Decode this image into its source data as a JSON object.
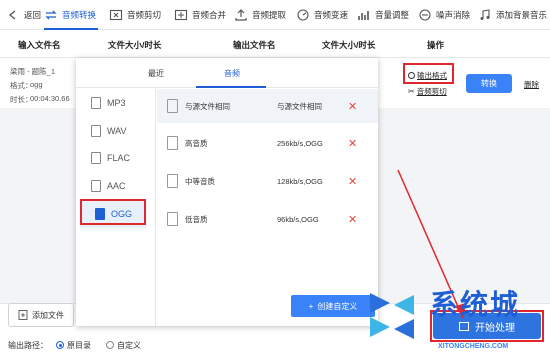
{
  "toolbar": {
    "back": "返回",
    "items": [
      "音频转换",
      "音频剪切",
      "音频合并",
      "音频提取",
      "音频变速",
      "音量调整",
      "噪声消除",
      "添加背景音乐"
    ]
  },
  "columns": {
    "input_name": "输入文件名",
    "size_duration": "文件大小/时长",
    "output_name": "输出文件名",
    "size_duration2": "文件大小/时长",
    "action": "操作"
  },
  "file": {
    "name": "梁雨 - 题陈_1",
    "format_label": "格式：",
    "format": "ogg",
    "duration_label": "时长：",
    "duration": "00:04:30.66"
  },
  "row_actions": {
    "output_format": "输出格式",
    "convert": "转换",
    "delete": "删除",
    "audio_cut": "音频剪切"
  },
  "popup": {
    "tabs": [
      "最近",
      "音频"
    ],
    "active_tab": "音频",
    "formats": [
      "MP3",
      "WAV",
      "FLAC",
      "AAC",
      "OGG"
    ],
    "selected_format": "OGG",
    "qualities": [
      {
        "name": "与源文件相同",
        "value": "与源文件相同"
      },
      {
        "name": "高音质",
        "value": "256kb/s,OGG"
      },
      {
        "name": "中等音质",
        "value": "128kb/s,OGG"
      },
      {
        "name": "低音质",
        "value": "96kb/s,OGG"
      }
    ],
    "create_custom": "创建自定义"
  },
  "bottom": {
    "add_file": "添加文件",
    "output_path": "输出路径：",
    "options": [
      "原目录",
      "自定义"
    ],
    "selected_option": "原目录",
    "start": "开始处理"
  },
  "watermark": {
    "text": "系统城",
    "url": "XITONGCHENG.COM"
  },
  "colors": {
    "accent": "#1f5fd6",
    "button": "#3a82f7",
    "highlight_box": "#e0272d",
    "delete": "#e0463f"
  }
}
